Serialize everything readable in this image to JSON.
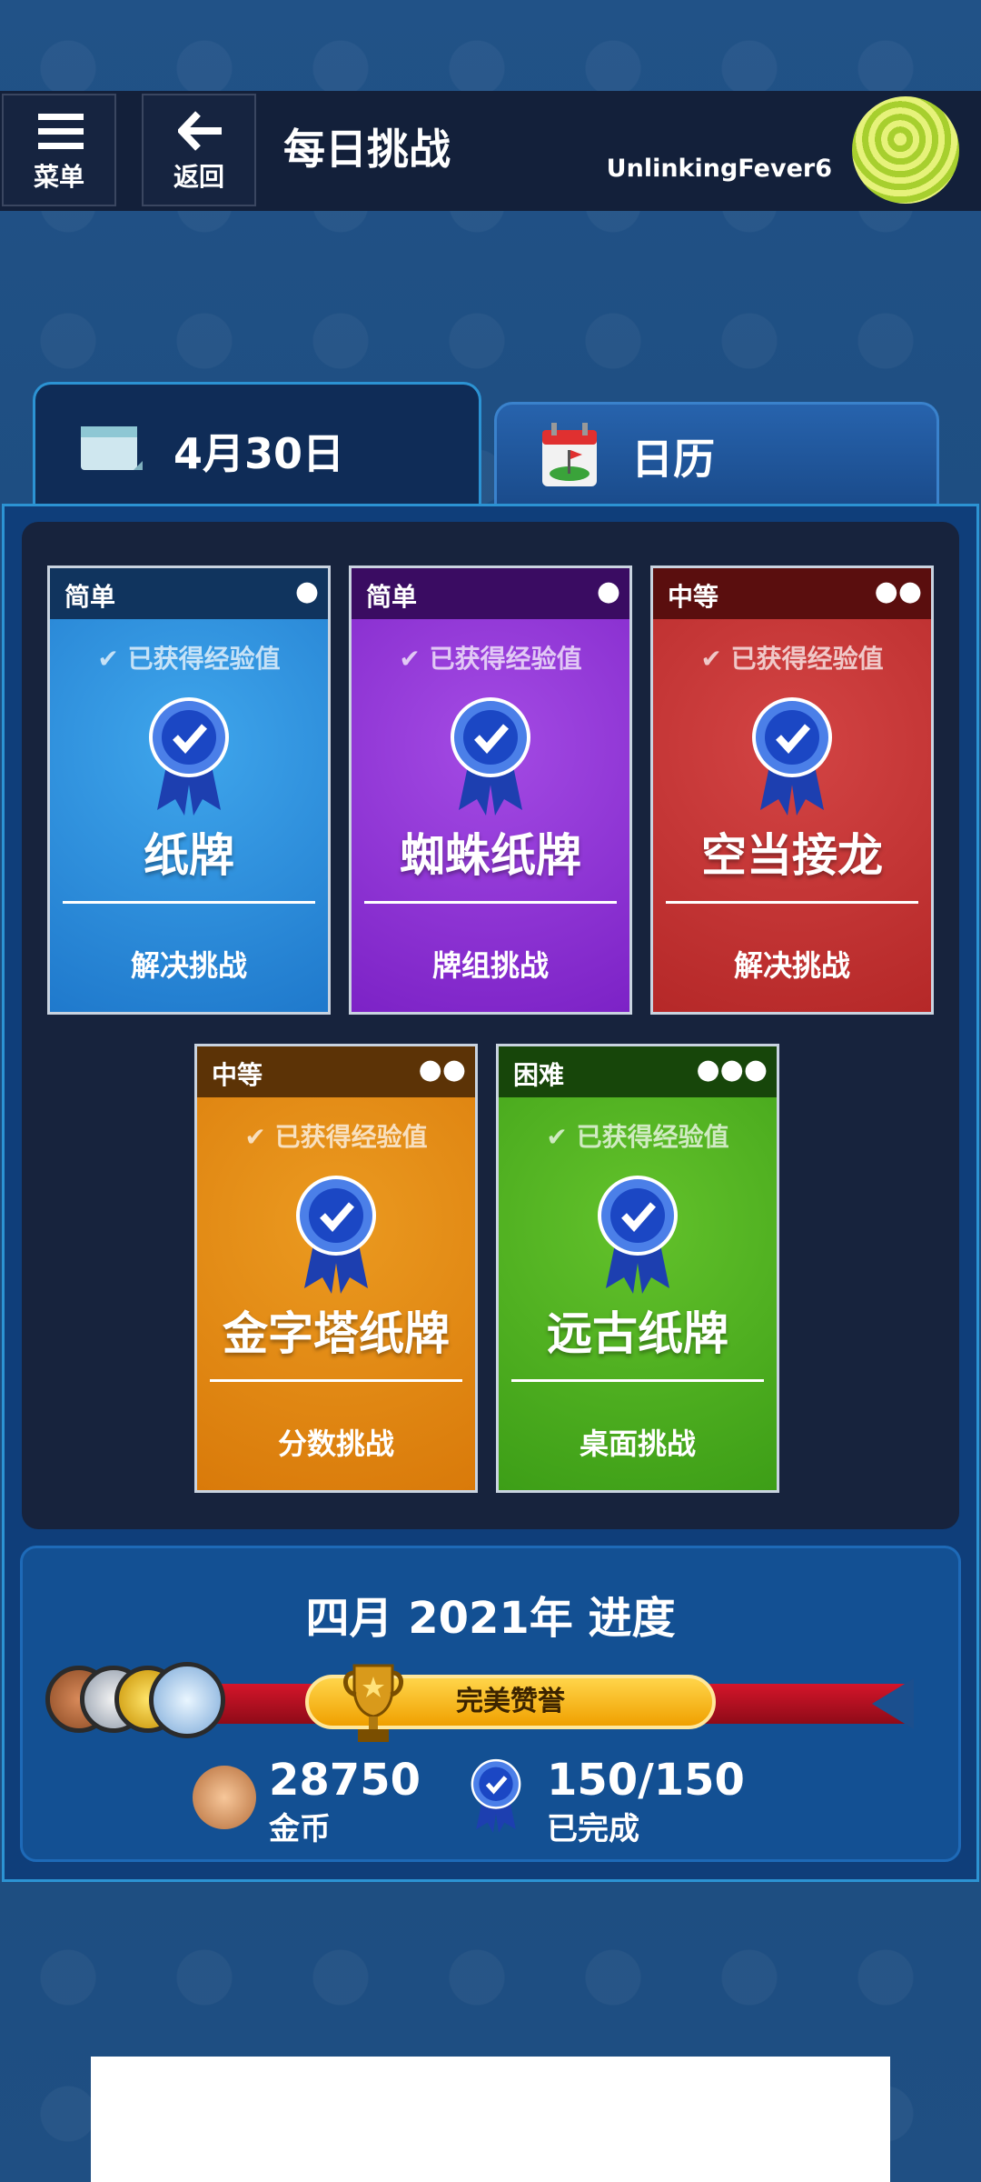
{
  "header": {
    "menu_label": "菜单",
    "back_label": "返回",
    "title": "每日挑战",
    "username": "UnlinkingFever6"
  },
  "tabs": [
    {
      "label": "4月30日",
      "icon": "calendar-icon"
    },
    {
      "label": "日历",
      "icon": "calendar-flag-icon"
    }
  ],
  "cards": [
    {
      "difficulty": "简单",
      "dots": "●",
      "earned": "✔ 已获得经验值",
      "game": "纸牌",
      "challenge": "解决挑战",
      "colors": {
        "top": "#1f79cc",
        "bottom": "#3fa6ec",
        "header": "#10345e"
      }
    },
    {
      "difficulty": "简单",
      "dots": "●",
      "earned": "✔ 已获得经验值",
      "game": "蜘蛛纸牌",
      "challenge": "牌组挑战",
      "colors": {
        "top": "#7c22c6",
        "bottom": "#a44be4",
        "header": "#3a0c62"
      }
    },
    {
      "difficulty": "中等",
      "dots": "●●",
      "earned": "✔ 已获得经验值",
      "game": "空当接龙",
      "challenge": "解决挑战",
      "colors": {
        "top": "#b52828",
        "bottom": "#d34444",
        "header": "#5a0e0e"
      }
    },
    {
      "difficulty": "中等",
      "dots": "●●",
      "earned": "✔ 已获得经验值",
      "game": "金字塔纸牌",
      "challenge": "分数挑战",
      "colors": {
        "top": "#d97a0a",
        "bottom": "#eb9a20",
        "header": "#5c3306"
      }
    },
    {
      "difficulty": "困难",
      "dots": "●●●",
      "earned": "✔ 已获得经验值",
      "game": "远古纸牌",
      "challenge": "桌面挑战",
      "colors": {
        "top": "#3d9e17",
        "bottom": "#63c22b",
        "header": "#17460a"
      }
    }
  ],
  "progress": {
    "title": "四月 2021年 进度",
    "banner": "完美赞誉",
    "coins_value": "28750",
    "coins_label": "金币",
    "completed_value": "150/150",
    "completed_label": "已完成"
  }
}
